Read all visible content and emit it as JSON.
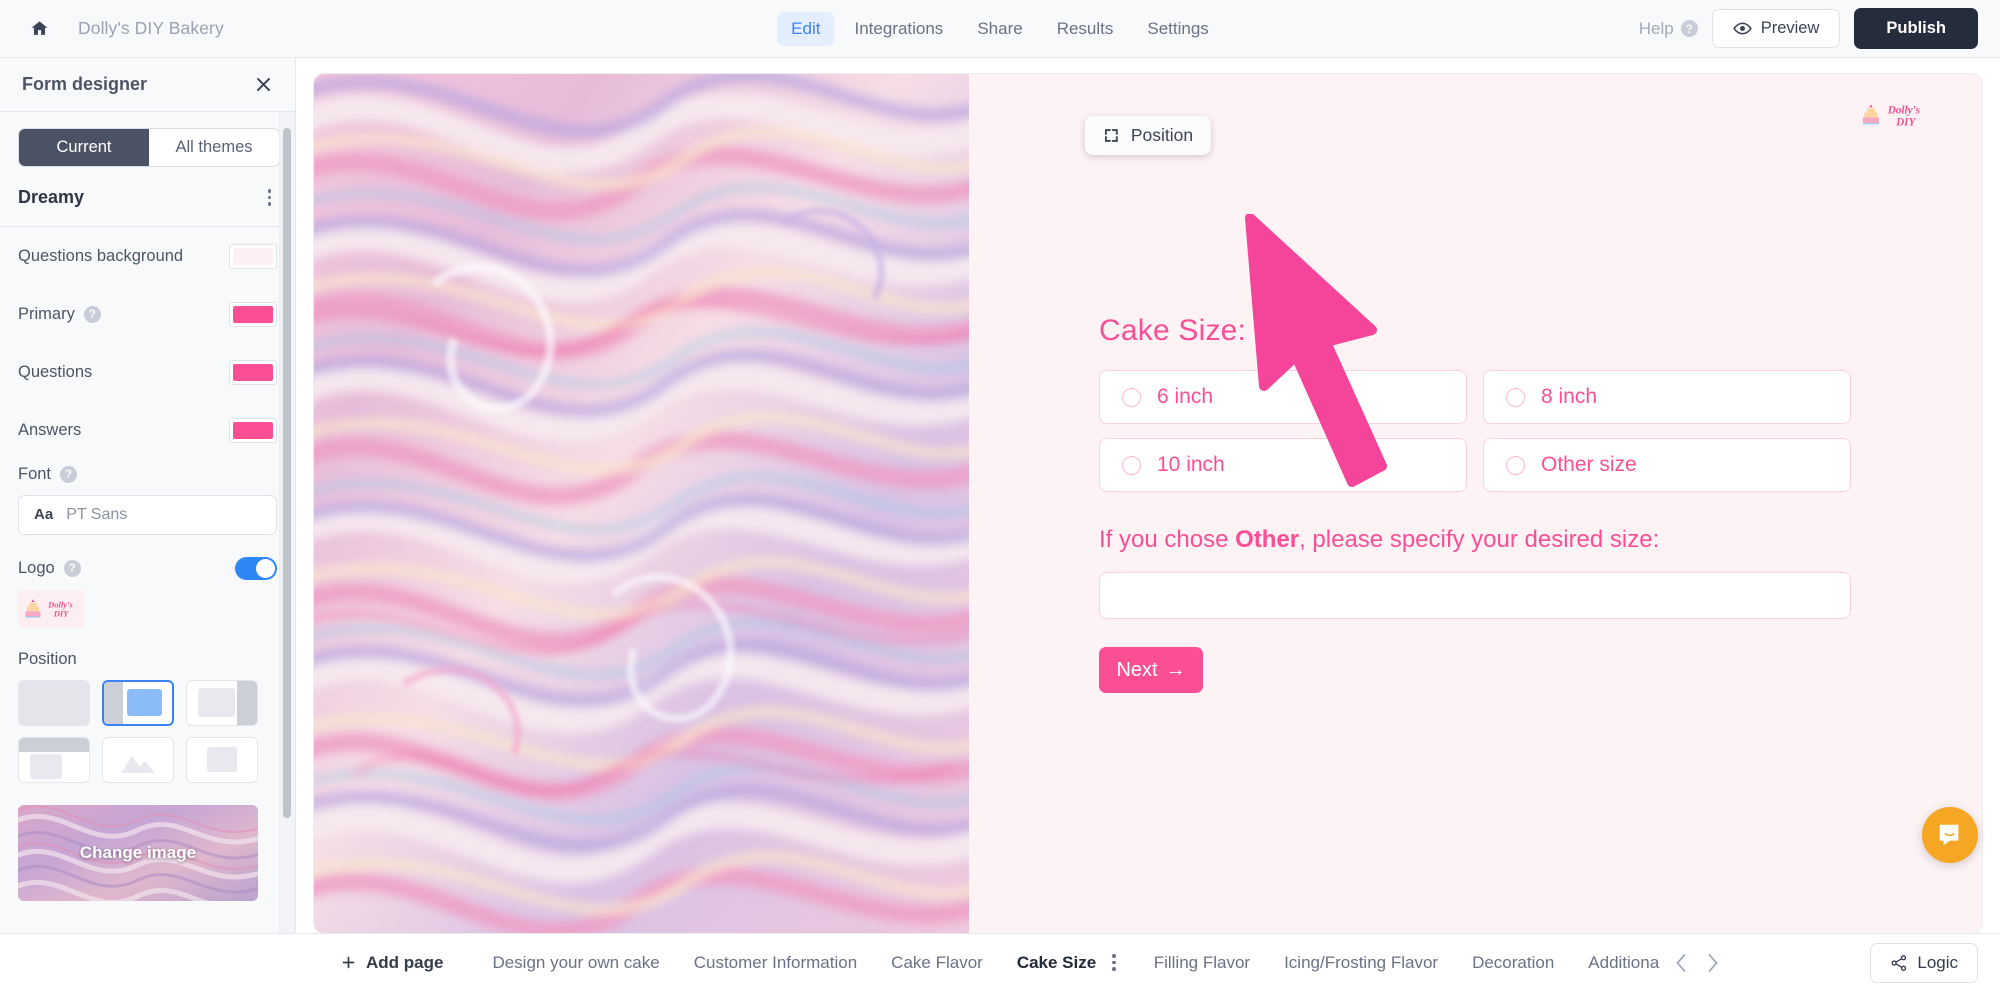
{
  "topbar": {
    "home_icon": "home-icon",
    "brand_title": "Dolly's DIY Bakery",
    "tabs": [
      {
        "label": "Edit",
        "active": true
      },
      {
        "label": "Integrations",
        "active": false
      },
      {
        "label": "Share",
        "active": false
      },
      {
        "label": "Results",
        "active": false
      },
      {
        "label": "Settings",
        "active": false
      }
    ],
    "help_label": "Help",
    "help_badge": "?",
    "preview_label": "Preview",
    "publish_label": "Publish"
  },
  "sidebar": {
    "title": "Form designer",
    "close_icon": "close-icon",
    "segments": [
      {
        "label": "Current",
        "active": true
      },
      {
        "label": "All themes",
        "active": false
      }
    ],
    "theme_name": "Dreamy",
    "properties": [
      {
        "label": "Questions background",
        "color": "#fcf0f3",
        "has_info": false
      },
      {
        "label": "Primary",
        "color": "#fa4f94",
        "has_info": true
      },
      {
        "label": "Questions",
        "color": "#fa4f94",
        "has_info": false
      },
      {
        "label": "Answers",
        "color": "#fa4f94",
        "has_info": false
      }
    ],
    "font": {
      "label": "Font",
      "aa": "Aa",
      "value": "PT Sans"
    },
    "logo": {
      "label": "Logo",
      "enabled": true
    },
    "position": {
      "label": "Position",
      "selected_index": 1,
      "options": [
        "full-bleed",
        "image-left",
        "image-right",
        "image-top",
        "image-center",
        "image-contained"
      ]
    },
    "change_image_label": "Change image"
  },
  "form": {
    "position_pill_label": "Position",
    "position_pill_icon": "resize-icon",
    "logo_text": "Dolly's DIY",
    "question_title": "Cake Size:",
    "options": [
      {
        "label": "6 inch",
        "selected": false
      },
      {
        "label": "8 inch",
        "selected": false
      },
      {
        "label": "10 inch",
        "selected": false
      },
      {
        "label": "Other size",
        "selected": false
      }
    ],
    "sub_question_pre": "If you chose ",
    "sub_question_bold": "Other",
    "sub_question_post": ", please specify your desired size:",
    "text_input_value": "",
    "next_label": "Next",
    "next_arrow": "→",
    "accent_color": "#fb4f95",
    "background_color": "#fdf2f4"
  },
  "bottombar": {
    "add_page_label": "Add page",
    "add_page_icon": "plus-icon",
    "pages": [
      {
        "label": "Design your own cake",
        "active": false
      },
      {
        "label": "Customer Information",
        "active": false
      },
      {
        "label": "Cake Flavor",
        "active": false
      },
      {
        "label": "Cake Size",
        "active": true
      },
      {
        "label": "Filling Flavor",
        "active": false
      },
      {
        "label": "Icing/Frosting Flavor",
        "active": false
      },
      {
        "label": "Decoration",
        "active": false
      },
      {
        "label": "Additiona",
        "active": false
      }
    ],
    "prev_icon": "chevron-left-icon",
    "next_icon": "chevron-right-icon",
    "logic_label": "Logic",
    "logic_icon": "share-nodes-icon"
  },
  "chat_widget": {
    "icon": "chat-bubble-icon",
    "color": "#f5a623"
  }
}
